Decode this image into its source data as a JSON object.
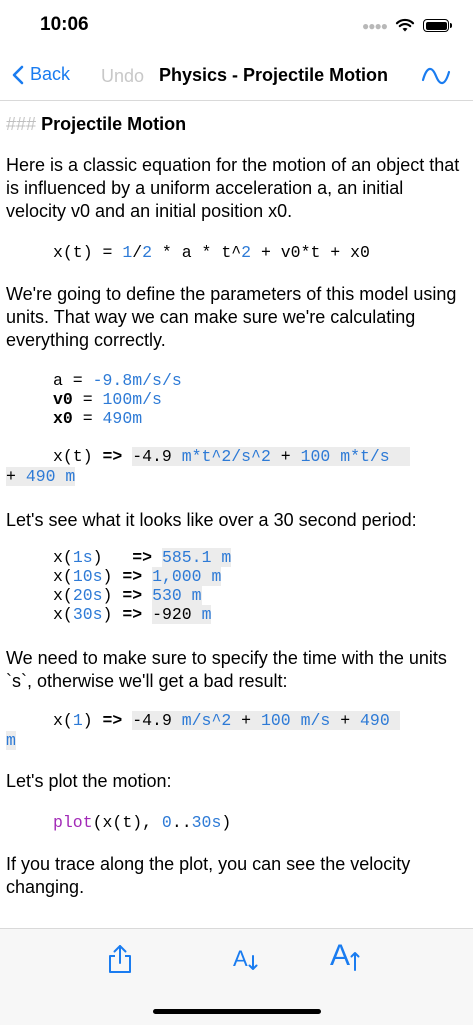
{
  "status": {
    "time": "10:06"
  },
  "nav": {
    "back": "Back",
    "undo": "Undo",
    "title": "Physics - Projectile Motion"
  },
  "doc": {
    "heading_marks": "###",
    "heading": "Projectile Motion",
    "intro": "Here is a classic equation for the motion of an object that is influenced by a uniform acceleration a, an initial velocity v0 and an initial position x0.",
    "eq1": {
      "lhs": "x(t) = ",
      "n1": "1",
      "slash": "/",
      "n2": "2",
      "rest1": " * a * t^",
      "n3": "2",
      "rest2": " + v0*t + x0"
    },
    "para2": "We're going to define the parameters of this model using units. That way we can make sure we're calculating everything correctly.",
    "params": [
      {
        "name": "a",
        "eq": " = ",
        "value": "-9.8",
        "unit": "m/s/s"
      },
      {
        "name": "v0",
        "eq": " = ",
        "value": "100",
        "unit": "m/s"
      },
      {
        "name": "x0",
        "eq": " = ",
        "value": "490",
        "unit": "m"
      }
    ],
    "eval": {
      "lhs": "x(t)",
      "arrow": " => ",
      "r1": "-4.9",
      "u1": " m*t^2/s^2",
      "r2": " + ",
      "r3": "100",
      "u2": " m*t/s",
      "line2a": "+ ",
      "r4": "490",
      "u3": " m"
    },
    "para3": "Let's see what it looks like over a 30 second period:",
    "samples": [
      {
        "call": "x(",
        "arg": "1",
        "unit": "s",
        "close": ")",
        "pad": "   ",
        "arrow": "=> ",
        "val": "585.1",
        "vunit": " m"
      },
      {
        "call": "x(",
        "arg": "10",
        "unit": "s",
        "close": ")",
        "pad": " ",
        "arrow": "=> ",
        "val": "1,000",
        "vunit": " m"
      },
      {
        "call": "x(",
        "arg": "20",
        "unit": "s",
        "close": ")",
        "pad": " ",
        "arrow": "=> ",
        "val": "530",
        "vunit": " m"
      },
      {
        "call": "x(",
        "arg": "30",
        "unit": "s",
        "close": ")",
        "pad": " ",
        "arrow": "=> ",
        "val": "-920",
        "vunit": " m"
      }
    ],
    "para4": "We need to make sure to specify the time with the units `s`, otherwise we'll get a bad result:",
    "bad": {
      "lhs": "x(",
      "arg": "1",
      "close": ")",
      "arrow": " => ",
      "r1": "-4.9",
      "u1": " m/s^2",
      "plus": " + ",
      "r2": "100",
      "u2": " m/s",
      "plus2": " + ",
      "r3": "490",
      "u3": "m"
    },
    "para5": "Let's plot the motion:",
    "plot": {
      "fn": "plot",
      "open": "(x(t), ",
      "range_start": "0",
      "dots": "..",
      "range_end": "30",
      "unit": "s",
      "close": ")"
    },
    "para6": "If you trace along the plot, you can see the velocity changing."
  },
  "toolbar": {
    "share_icon": "share-icon",
    "decrease_icon": "font-decrease-icon",
    "increase_icon": "font-increase-icon",
    "label_small": "A",
    "label_big": "A"
  },
  "colors": {
    "accent": "#1a7cf0",
    "number": "#2d7ad6",
    "function": "#a22ab7",
    "result_bg": "#ececec"
  }
}
